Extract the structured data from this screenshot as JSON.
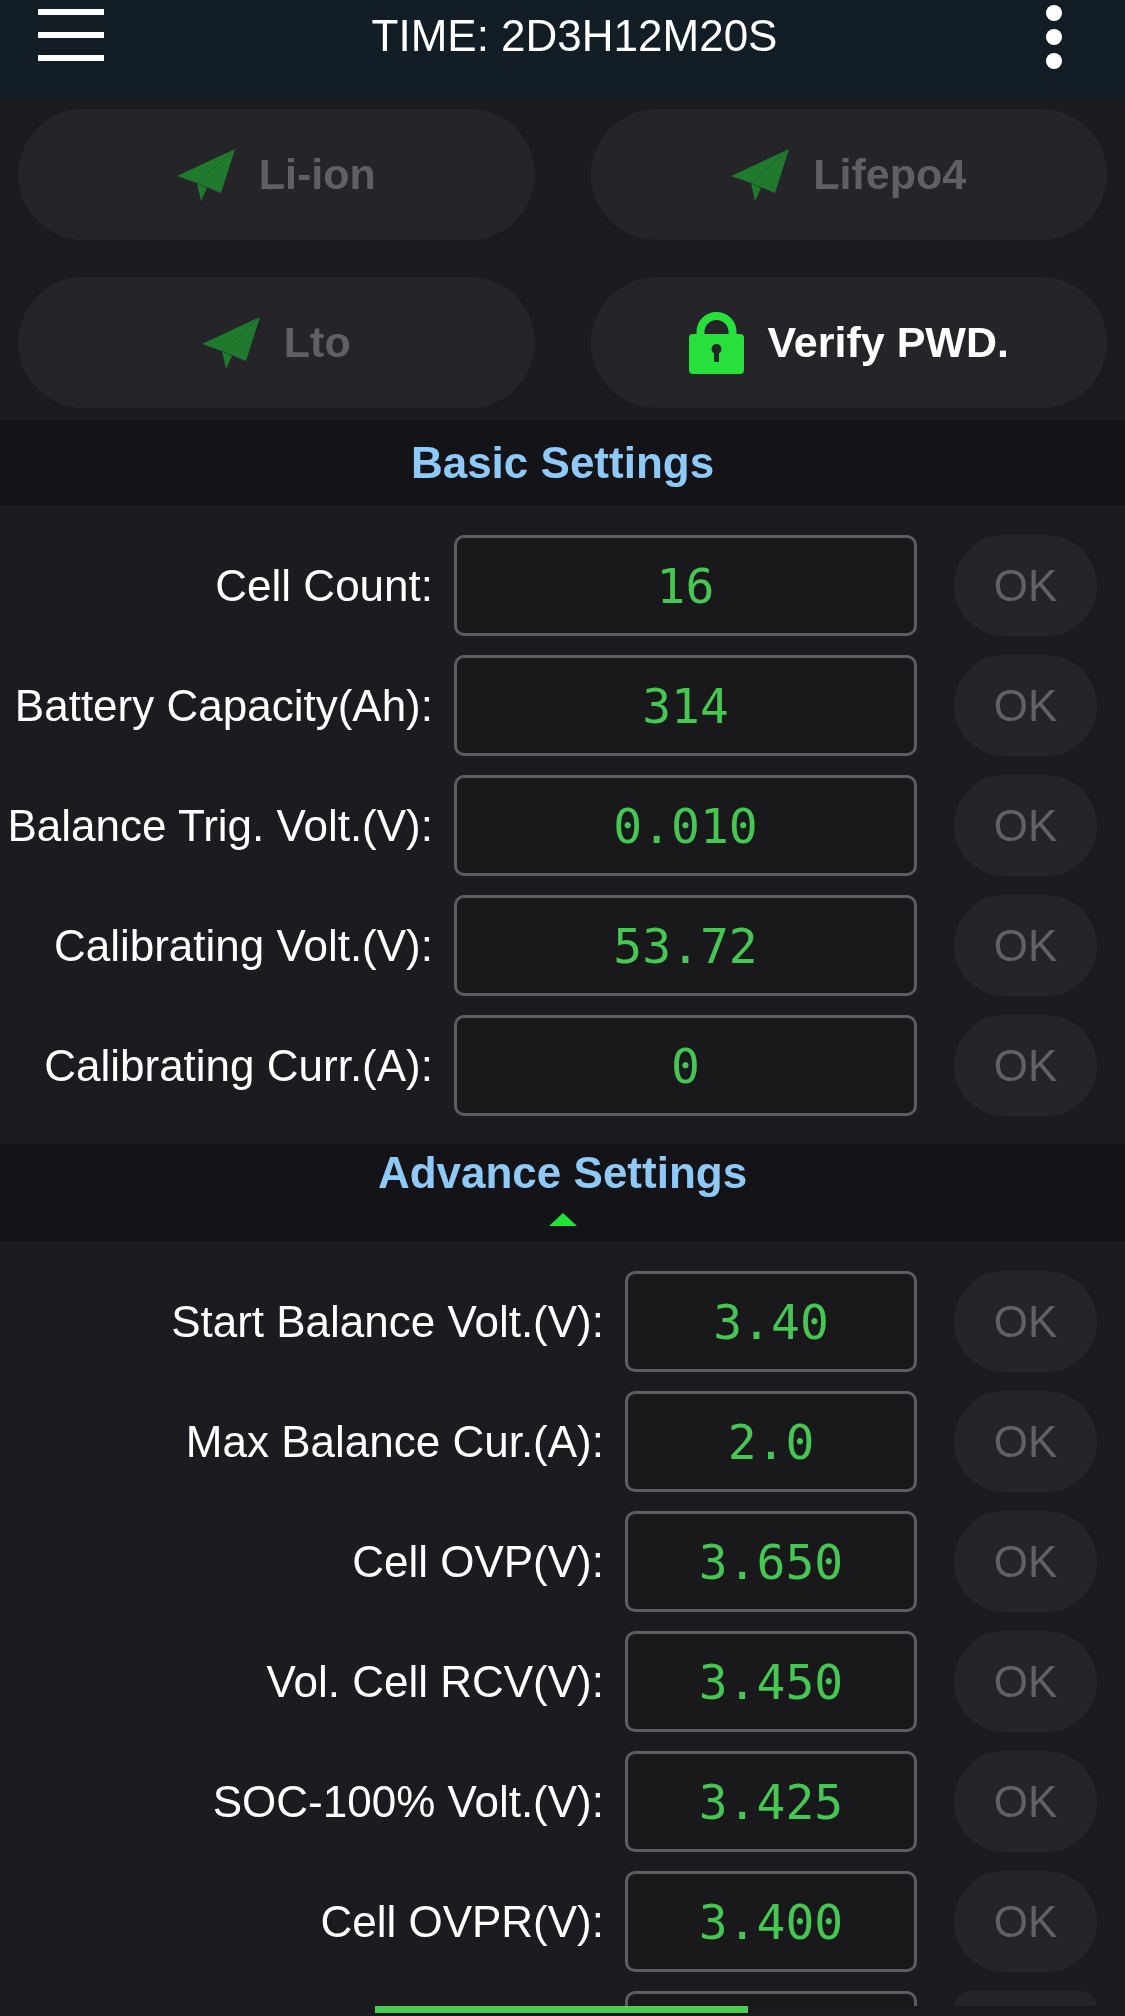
{
  "header": {
    "title": "TIME: 2D3H12M20S"
  },
  "mode_buttons": [
    {
      "label": "Li-ion",
      "kind": "preset",
      "disabled": true
    },
    {
      "label": "Lifepo4",
      "kind": "preset",
      "disabled": true
    },
    {
      "label": "Lto",
      "kind": "preset",
      "disabled": true
    },
    {
      "label": "Verify PWD.",
      "kind": "password",
      "disabled": false
    }
  ],
  "sections": [
    {
      "title": "Basic Settings",
      "kind": "basic",
      "rows": [
        {
          "label": "Cell Count:",
          "value": "16",
          "ok": {
            "label": "OK",
            "disabled": true
          }
        },
        {
          "label": "Battery Capacity(Ah):",
          "value": "314",
          "ok": {
            "label": "OK",
            "disabled": true
          }
        },
        {
          "label": "Balance Trig. Volt.(V):",
          "value": "0.010",
          "ok": {
            "label": "OK",
            "disabled": true
          }
        },
        {
          "label": "Calibrating Volt.(V):",
          "value": "53.72",
          "ok": {
            "label": "OK",
            "disabled": true
          }
        },
        {
          "label": "Calibrating Curr.(A):",
          "value": "0",
          "ok": {
            "label": "OK",
            "disabled": true
          }
        }
      ]
    },
    {
      "title": "Advance Settings",
      "kind": "advanced",
      "expanded": true,
      "rows": [
        {
          "label": "Start Balance Volt.(V):",
          "value": "3.40",
          "ok": {
            "label": "OK",
            "disabled": true
          }
        },
        {
          "label": "Max Balance Cur.(A):",
          "value": "2.0",
          "ok": {
            "label": "OK",
            "disabled": true
          }
        },
        {
          "label": "Cell OVP(V):",
          "value": "3.650",
          "ok": {
            "label": "OK",
            "disabled": true
          }
        },
        {
          "label": "Vol. Cell RCV(V):",
          "value": "3.450",
          "ok": {
            "label": "OK",
            "disabled": true
          }
        },
        {
          "label": "SOC-100% Volt.(V):",
          "value": "3.425",
          "ok": {
            "label": "OK",
            "disabled": true
          }
        },
        {
          "label": "Cell OVPR(V):",
          "value": "3.400",
          "ok": {
            "label": "OK",
            "disabled": true
          }
        },
        {
          "cut_off": true
        }
      ]
    }
  ]
}
